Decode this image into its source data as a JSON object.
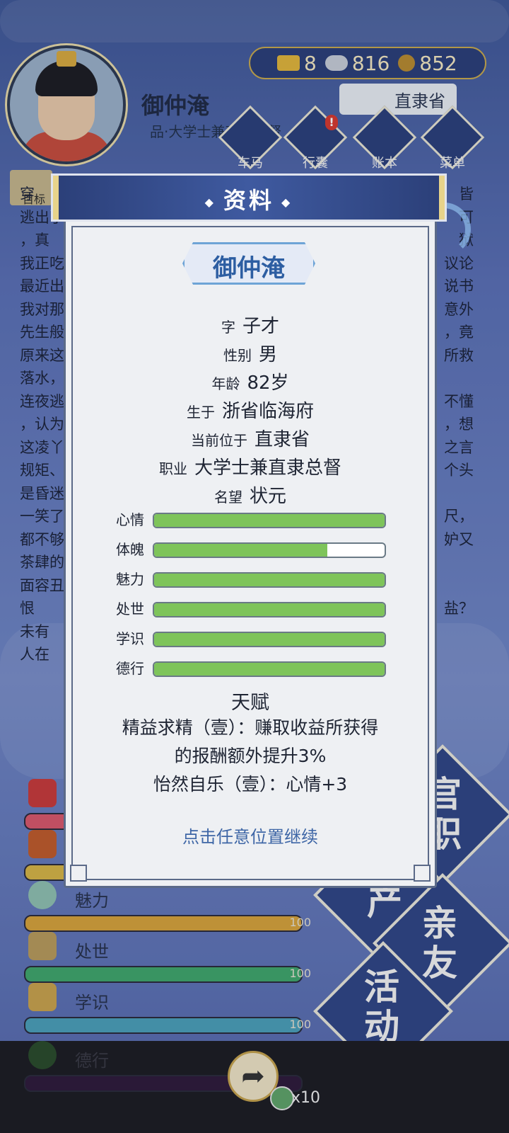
{
  "player": {
    "name": "御仲淹",
    "title": "品·大学士兼直隶总督"
  },
  "currency": [
    {
      "icon": "gold-ingot-icon",
      "value": "8"
    },
    {
      "icon": "silver-ingot-icon",
      "value": "816"
    },
    {
      "icon": "copper-coin-icon",
      "value": "852"
    }
  ],
  "location": "直隶省",
  "nav": [
    {
      "label": "车马",
      "icon": "carriage-icon"
    },
    {
      "label": "行囊",
      "icon": "bag-icon",
      "badge": "!"
    },
    {
      "label": "账本",
      "icon": "ledger-icon"
    },
    {
      "label": "菜单",
      "icon": "menu-icon"
    }
  ],
  "goal_label": "目标",
  "story_lines": [
    "穿",
    "逃出了",
    "，真",
    "我正吃",
    "最近出",
    "我对那",
    "先生般",
    "原来这",
    "落水，",
    "连夜逃",
    "，认为",
    "这凌丫",
    "规矩、",
    "是昏迷",
    "一笑了",
    "都不够",
    "茶肆的",
    "面容丑",
    "恨",
    "未有",
    "人在"
  ],
  "story_right": [
    "皆",
    "可",
    "狱",
    "议论",
    "说书",
    "意外",
    "，竟",
    "所救",
    "",
    "不懂",
    "，想",
    "之言",
    "个头",
    "",
    "尺，",
    "妒又",
    "",
    "",
    "盐？"
  ],
  "background_stats": [
    {
      "name": "",
      "value": "",
      "color": "#d9576a",
      "icon": "flower-icon"
    },
    {
      "name": "",
      "value": "",
      "color": "#d6b445",
      "icon": "lantern-icon"
    },
    {
      "name": "魅力",
      "value": "100",
      "color": "#d6a23a",
      "icon": "jade-icon"
    },
    {
      "name": "处世",
      "value": "100",
      "color": "#3fa66a",
      "icon": "sachet-icon"
    },
    {
      "name": "学识",
      "value": "100",
      "color": "#4a9fb8",
      "icon": "books-icon"
    },
    {
      "name": "德行",
      "value": "",
      "color": "#5b2a7a",
      "icon": "abacus-icon"
    }
  ],
  "side_buttons": [
    "官职",
    "产",
    "亲友",
    "活动"
  ],
  "bottom": {
    "multiplier": "x10"
  },
  "dialog": {
    "title": "资料",
    "name": "御仲淹",
    "fields": [
      {
        "key": "字",
        "value": "子才"
      },
      {
        "key": "性别",
        "value": "男"
      },
      {
        "key": "年龄",
        "value": "82岁"
      },
      {
        "key": "生于",
        "value": "浙省临海府"
      },
      {
        "key": "当前位于",
        "value": "直隶省"
      },
      {
        "key": "职业",
        "value": "大学士兼直隶总督"
      },
      {
        "key": "名望",
        "value": "状元"
      }
    ],
    "bars": [
      {
        "label": "心情",
        "fraction": 1.0
      },
      {
        "label": "体魄",
        "fraction": 0.75
      },
      {
        "label": "魅力",
        "fraction": 1.0
      },
      {
        "label": "处世",
        "fraction": 1.0
      },
      {
        "label": "学识",
        "fraction": 1.0
      },
      {
        "label": "德行",
        "fraction": 1.0
      }
    ],
    "talent_title": "天赋",
    "talents": [
      "精益求精（壹）：赚取收益所获得",
      "的报酬额外提升3%",
      "怡然自乐（壹）：心情+3"
    ],
    "continue": "点击任意位置继续"
  },
  "colors": {
    "accent": "#2b3f78",
    "bar_fill": "#7ec45a",
    "link": "#3e66a6"
  }
}
